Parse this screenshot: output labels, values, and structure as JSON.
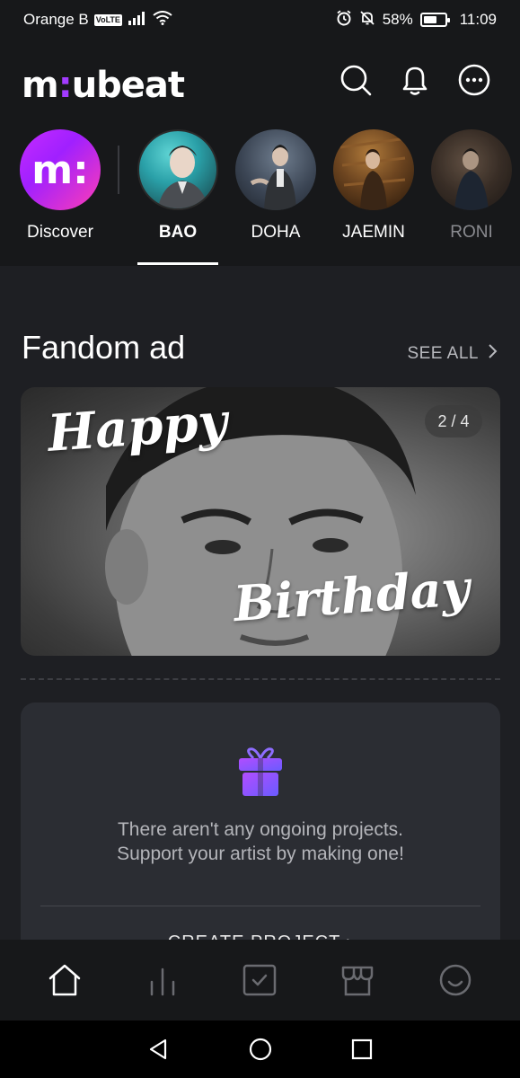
{
  "status_bar": {
    "carrier": "Orange B",
    "volte": "VoLTE",
    "battery": "58%",
    "time": "11:09"
  },
  "header": {
    "logo_prefix": "m",
    "logo_dot": ":",
    "logo_suffix": "ubeat",
    "icons": [
      "search-icon",
      "bell-icon",
      "more-icon"
    ]
  },
  "artists": [
    {
      "name": "Discover",
      "state": "normal"
    },
    {
      "name": "BAO",
      "state": "active"
    },
    {
      "name": "DOHA",
      "state": "normal"
    },
    {
      "name": "JAEMIN",
      "state": "normal"
    },
    {
      "name": "RONI",
      "state": "faded"
    }
  ],
  "discover_logo": "m:",
  "fandom_ad": {
    "title": "Fandom ad",
    "see_all": "SEE ALL",
    "counter": "2 / 4",
    "text_top": "Happy",
    "text_bottom": "Birthday"
  },
  "projects": {
    "message_line1": "There aren't any ongoing projects.",
    "message_line2": "Support your artist by making one!",
    "create_label": "CREATE PROJECT"
  },
  "bottom_nav": [
    "home-icon",
    "chart-icon",
    "vote-icon",
    "store-icon",
    "profile-icon"
  ],
  "colors": {
    "accent": "#a23bff",
    "background": "#1e1f23",
    "header_bg": "#17181a",
    "card_bg": "#2b2d33"
  }
}
